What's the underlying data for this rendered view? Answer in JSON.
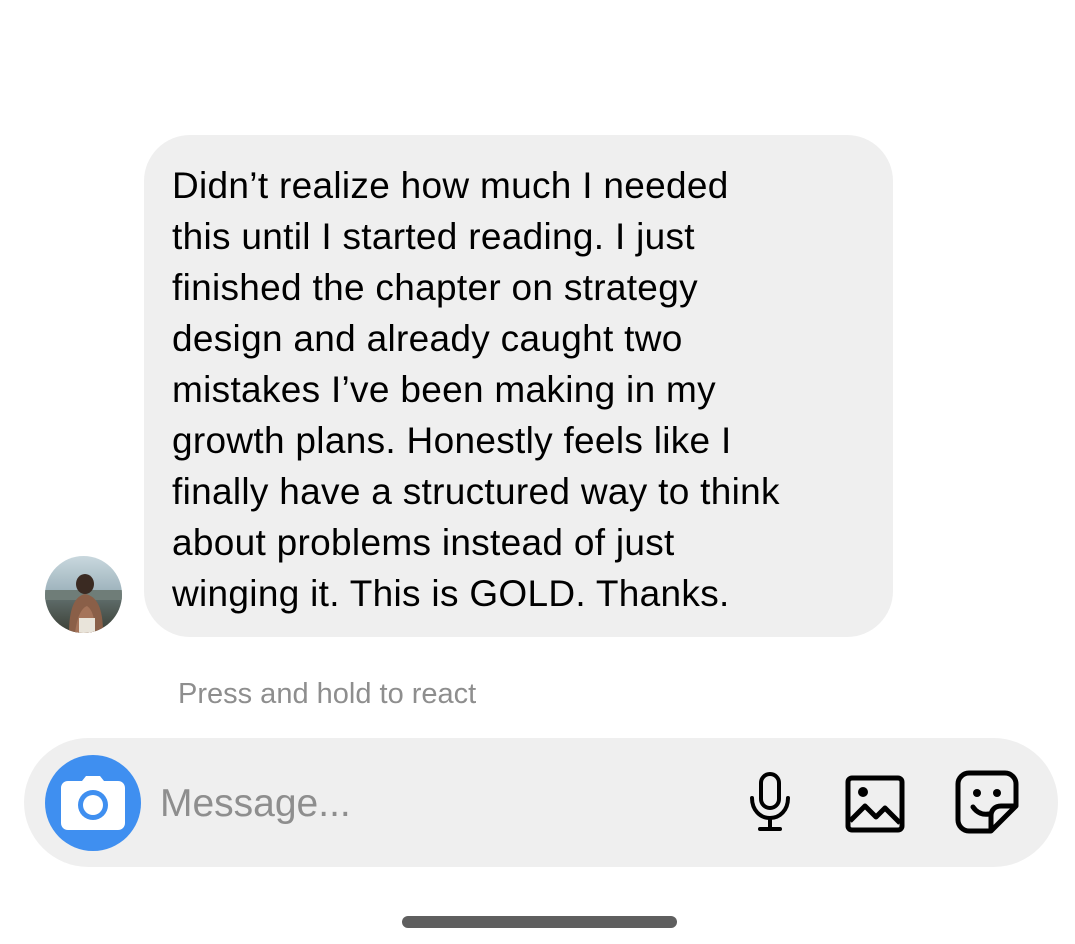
{
  "message": {
    "text": "Didn’t realize how much I needed\nthis until I started reading. I just\nfinished the chapter on strategy\ndesign and already caught two\nmistakes I’ve been making in my\ngrowth plans. Honestly feels like I\nfinally have a structured way to think\nabout problems instead of just\nwinging it. This is GOLD. Thanks.",
    "avatar_icon": "user-photo-avatar"
  },
  "react_hint": "Press and hold to react",
  "composer": {
    "placeholder": "Message...",
    "value": "",
    "camera_icon": "camera-icon",
    "mic_icon": "microphone-icon",
    "photo_icon": "photo-gallery-icon",
    "sticker_icon": "sticker-icon"
  },
  "colors": {
    "bubble_bg": "#efefef",
    "accent": "#3f8ff0",
    "hint_text": "#8e8e8e"
  }
}
